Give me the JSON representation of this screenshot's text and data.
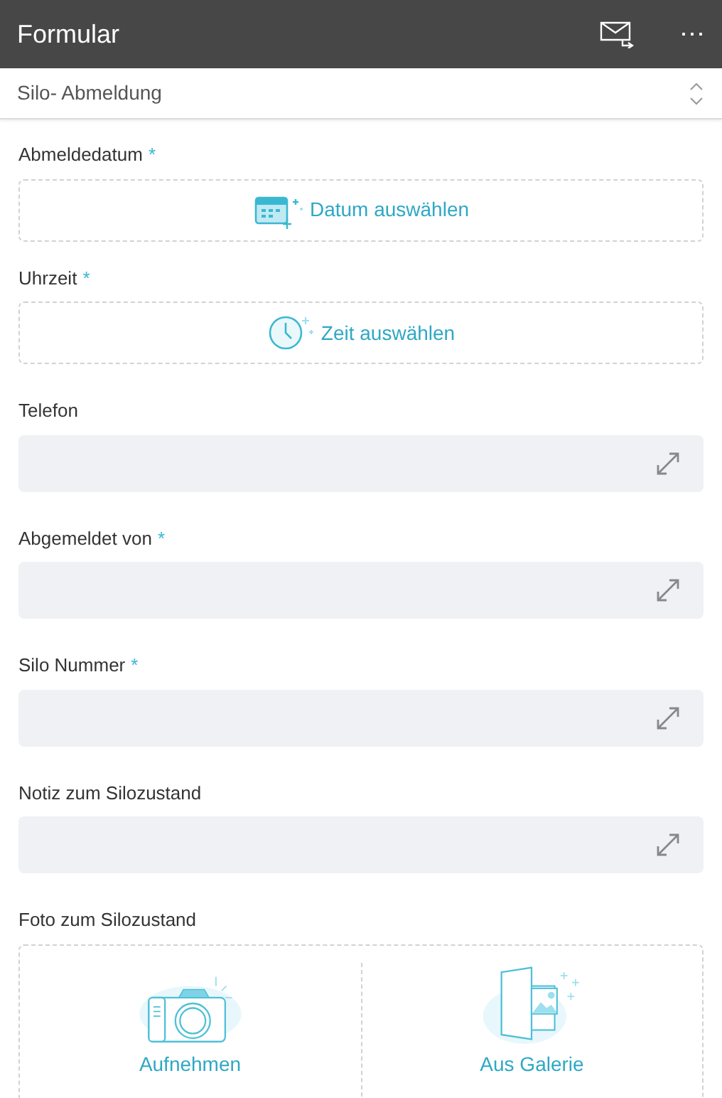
{
  "header": {
    "title": "Formular",
    "menu": "⋯"
  },
  "form_select": {
    "value": "Silo- Abmeldung"
  },
  "fields": [
    {
      "kind": "date",
      "label": "Abmeldedatum",
      "required_mark": "*",
      "button": "Datum auswählen"
    },
    {
      "kind": "time",
      "label": "Uhrzeit",
      "required_mark": "*",
      "button": "Zeit auswählen"
    },
    {
      "kind": "text",
      "label": "Telefon"
    },
    {
      "kind": "text",
      "label": "Abgemeldet von",
      "required_mark": "*"
    },
    {
      "kind": "text",
      "label": "Silo Nummer",
      "required_mark": "*"
    },
    {
      "kind": "text",
      "label": "Notiz zum Silozustand"
    },
    {
      "kind": "photo",
      "label": "Foto zum Silozustand",
      "capture": "Aufnehmen",
      "gallery": "Aus Galerie"
    }
  ]
}
